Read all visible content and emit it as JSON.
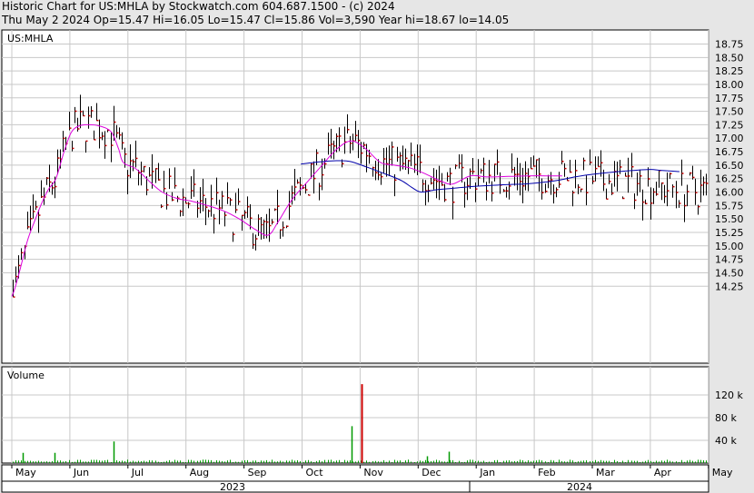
{
  "header": {
    "title": "Historic Chart for US:MHLA by Stockwatch.com 604.687.1500 - (c) 2024",
    "stats": "Thu May  2 2024  Op=15.47  Hi=16.05  Lo=15.47  Cl=15.86  Vol=3,590  Year hi=18.67  lo=14.05"
  },
  "chart_data": {
    "type": "line",
    "symbol_label": "US:MHLA",
    "volume_label": "Volume",
    "price_ticks": [
      "18.75",
      "18.50",
      "18.25",
      "18.00",
      "17.75",
      "17.50",
      "17.25",
      "17.00",
      "16.75",
      "16.50",
      "16.25",
      "16.00",
      "15.75",
      "15.50",
      "15.25",
      "15.00",
      "14.75",
      "14.50",
      "14.25"
    ],
    "volume_ticks": [
      "120 k",
      "80 k",
      "40 k"
    ],
    "months": [
      "May",
      "Jun",
      "Jul",
      "Aug",
      "Sep",
      "Oct",
      "Nov",
      "Dec",
      "Jan",
      "Feb",
      "Mar",
      "Apr",
      "May"
    ],
    "years": [
      "2023",
      "2024"
    ],
    "ylim": [
      14.05,
      18.9
    ],
    "volume_ylim": [
      0,
      150000
    ],
    "grid": true,
    "colors": {
      "background": "#ffffff",
      "grid": "#c8c8c8",
      "bars": "#000000",
      "close_tick": "#cc0000",
      "ma_short": "#dd00dd",
      "ma_long": "#0000aa",
      "volume": "#009900",
      "volume_spike": "#cc0000"
    },
    "series": [
      {
        "values": [
          [
            0.0,
            14.06
          ],
          [
            0.05,
            14.2
          ],
          [
            0.14,
            14.55
          ],
          [
            0.27,
            15.1
          ],
          [
            0.39,
            15.45
          ],
          [
            0.51,
            15.78
          ],
          [
            0.63,
            16.05
          ],
          [
            0.76,
            16.25
          ],
          [
            0.9,
            16.75
          ],
          [
            1.02,
            17.1
          ],
          [
            1.14,
            17.22
          ],
          [
            1.3,
            17.25
          ],
          [
            1.5,
            17.23
          ],
          [
            1.71,
            17.12
          ],
          [
            1.84,
            16.8
          ],
          [
            1.92,
            16.55
          ],
          [
            2.14,
            16.43
          ],
          [
            2.37,
            16.2
          ],
          [
            2.59,
            16.0
          ],
          [
            2.85,
            15.88
          ],
          [
            3.1,
            15.83
          ],
          [
            3.37,
            15.75
          ],
          [
            3.65,
            15.65
          ],
          [
            3.92,
            15.5
          ],
          [
            4.2,
            15.3
          ],
          [
            4.42,
            15.2
          ],
          [
            4.59,
            15.45
          ],
          [
            4.82,
            15.85
          ],
          [
            5.1,
            16.2
          ],
          [
            5.33,
            16.48
          ],
          [
            5.6,
            16.8
          ],
          [
            5.85,
            16.95
          ],
          [
            6.1,
            16.8
          ],
          [
            6.35,
            16.55
          ],
          [
            6.59,
            16.5
          ],
          [
            6.85,
            16.45
          ],
          [
            7.1,
            16.35
          ],
          [
            7.4,
            16.2
          ],
          [
            7.6,
            16.15
          ],
          [
            7.9,
            16.3
          ],
          [
            8.2,
            16.28
          ],
          [
            8.55,
            16.29
          ],
          [
            8.9,
            16.3
          ],
          [
            9.2,
            16.3
          ],
          [
            9.48,
            16.3
          ]
        ]
      },
      {
        "values": [
          [
            4.98,
            16.52
          ],
          [
            5.3,
            16.56
          ],
          [
            5.55,
            16.58
          ],
          [
            5.82,
            16.57
          ],
          [
            6.1,
            16.47
          ],
          [
            6.4,
            16.35
          ],
          [
            6.7,
            16.22
          ],
          [
            6.9,
            16.08
          ],
          [
            7.05,
            16.0
          ],
          [
            7.3,
            16.04
          ],
          [
            7.6,
            16.07
          ],
          [
            7.9,
            16.1
          ],
          [
            8.2,
            16.12
          ],
          [
            8.55,
            16.14
          ],
          [
            8.85,
            16.15
          ],
          [
            9.15,
            16.18
          ],
          [
            9.42,
            16.22
          ],
          [
            9.7,
            16.28
          ],
          [
            10.0,
            16.33
          ],
          [
            10.35,
            16.37
          ],
          [
            10.7,
            16.4
          ],
          [
            11.0,
            16.42
          ],
          [
            11.2,
            16.4
          ],
          [
            11.5,
            16.38
          ]
        ]
      }
    ]
  }
}
